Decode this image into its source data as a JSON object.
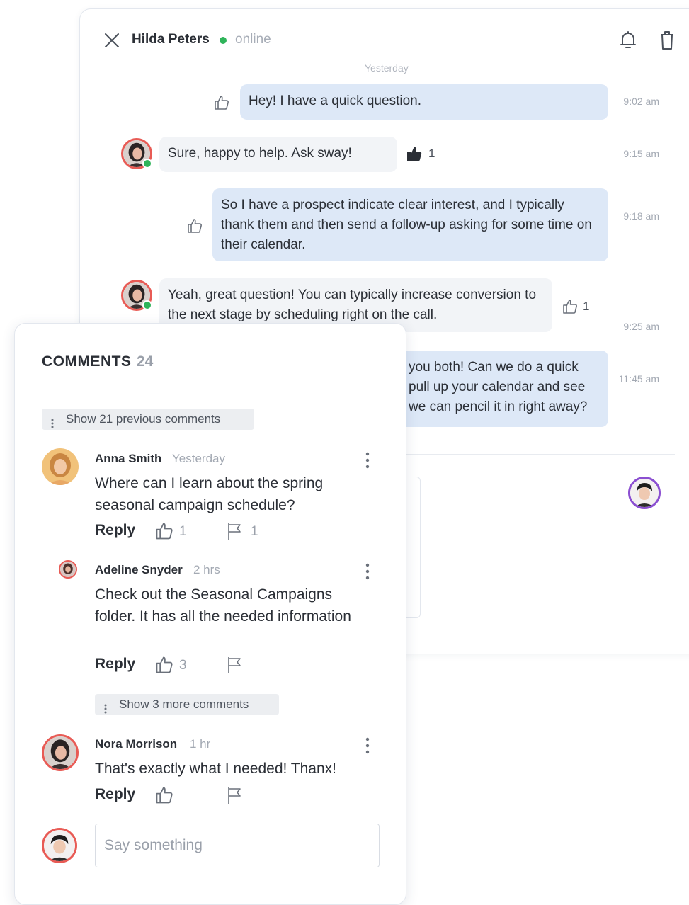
{
  "chat": {
    "contact_name": "Hilda Peters",
    "status": "online",
    "day_separator": "Yesterday",
    "messages": [
      {
        "direction": "out",
        "text": "Hey! I have a quick question.",
        "time": "9:02 am",
        "likes": ""
      },
      {
        "direction": "in",
        "text": "Sure, happy to help. Ask sway!",
        "time": "9:15 am",
        "likes": "1"
      },
      {
        "direction": "out",
        "text": "So I have a prospect indicate clear interest, and I typically thank them and then send a follow-up asking for some time on their calendar.",
        "time": "9:18 am",
        "likes": ""
      },
      {
        "direction": "in",
        "text": "Yeah, great question! You can typically increase conversion to the next stage by scheduling right on the call.",
        "time": "9:25 am",
        "likes": "1"
      },
      {
        "direction": "out",
        "text": "you both! Can we do a quick pull up your calendar and see we can pencil it in right away?",
        "time": "11:45 am",
        "likes": ""
      }
    ]
  },
  "comments": {
    "title": "COMMENTS",
    "count": "24",
    "show_previous": "Show 21 previous comments",
    "show_more": "Show 3 more comments",
    "reply_label": "Reply",
    "items": [
      {
        "author": "Anna Smith",
        "when": "Yesterday",
        "text": "Where can I learn about the spring seasonal campaign schedule?",
        "likes": "1",
        "flags": "1"
      },
      {
        "author": "Adeline Snyder",
        "when": "2 hrs",
        "text": "Check out the Seasonal Campaigns folder. It has all the needed information",
        "likes": "3",
        "flags": ""
      },
      {
        "author": "Nora Morrison",
        "when": "1 hr",
        "text": "That's exactly what I needed! Thanx!",
        "likes": "",
        "flags": ""
      }
    ],
    "input_placeholder": "Say something"
  },
  "colors": {
    "accent_online": "#2fb45a",
    "outgoing_bubble": "#dde8f7",
    "incoming_bubble": "#f2f4f7",
    "avatar_ring_red": "#e85b55",
    "avatar_ring_purple": "#8b4fd1"
  },
  "icons": [
    "close-icon",
    "bell-icon",
    "trash-icon",
    "thumbs-up-icon",
    "thumbs-up-filled-icon",
    "flag-icon",
    "kebab-menu-icon"
  ]
}
